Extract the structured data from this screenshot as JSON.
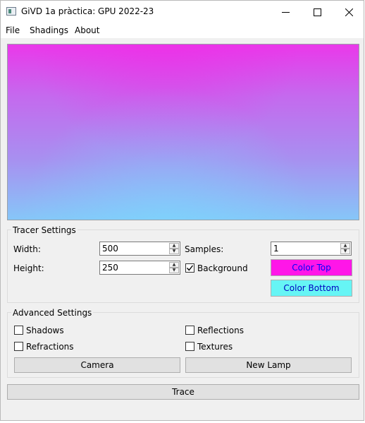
{
  "window": {
    "title": "GiVD 1a pràctica: GPU 2022-23",
    "minimize_icon": "minimize-icon",
    "maximize_icon": "maximize-icon",
    "close_icon": "close-icon"
  },
  "menu": {
    "items": [
      "File",
      "Shadings",
      "About"
    ]
  },
  "viewport": {
    "gradient_top": "#ea38ea",
    "gradient_bottom": "#86c6f8"
  },
  "tracer": {
    "title": "Tracer Settings",
    "width_label": "Width:",
    "width_value": "500",
    "height_label": "Height:",
    "height_value": "250",
    "samples_label": "Samples:",
    "samples_value": "1",
    "background_label": "Background",
    "background_checked": true,
    "color_top_label": "Color Top",
    "color_top_bg": "#ff16e8",
    "color_top_fg": "#0000ff",
    "color_bottom_label": "Color Bottom",
    "color_bottom_bg": "#66f5f5",
    "color_bottom_fg": "#0000c0"
  },
  "advanced": {
    "title": "Advanced Settings",
    "shadows_label": "Shadows",
    "refractions_label": "Refractions",
    "reflections_label": "Reflections",
    "textures_label": "Textures",
    "camera_label": "Camera",
    "new_lamp_label": "New Lamp"
  },
  "trace_label": "Trace"
}
